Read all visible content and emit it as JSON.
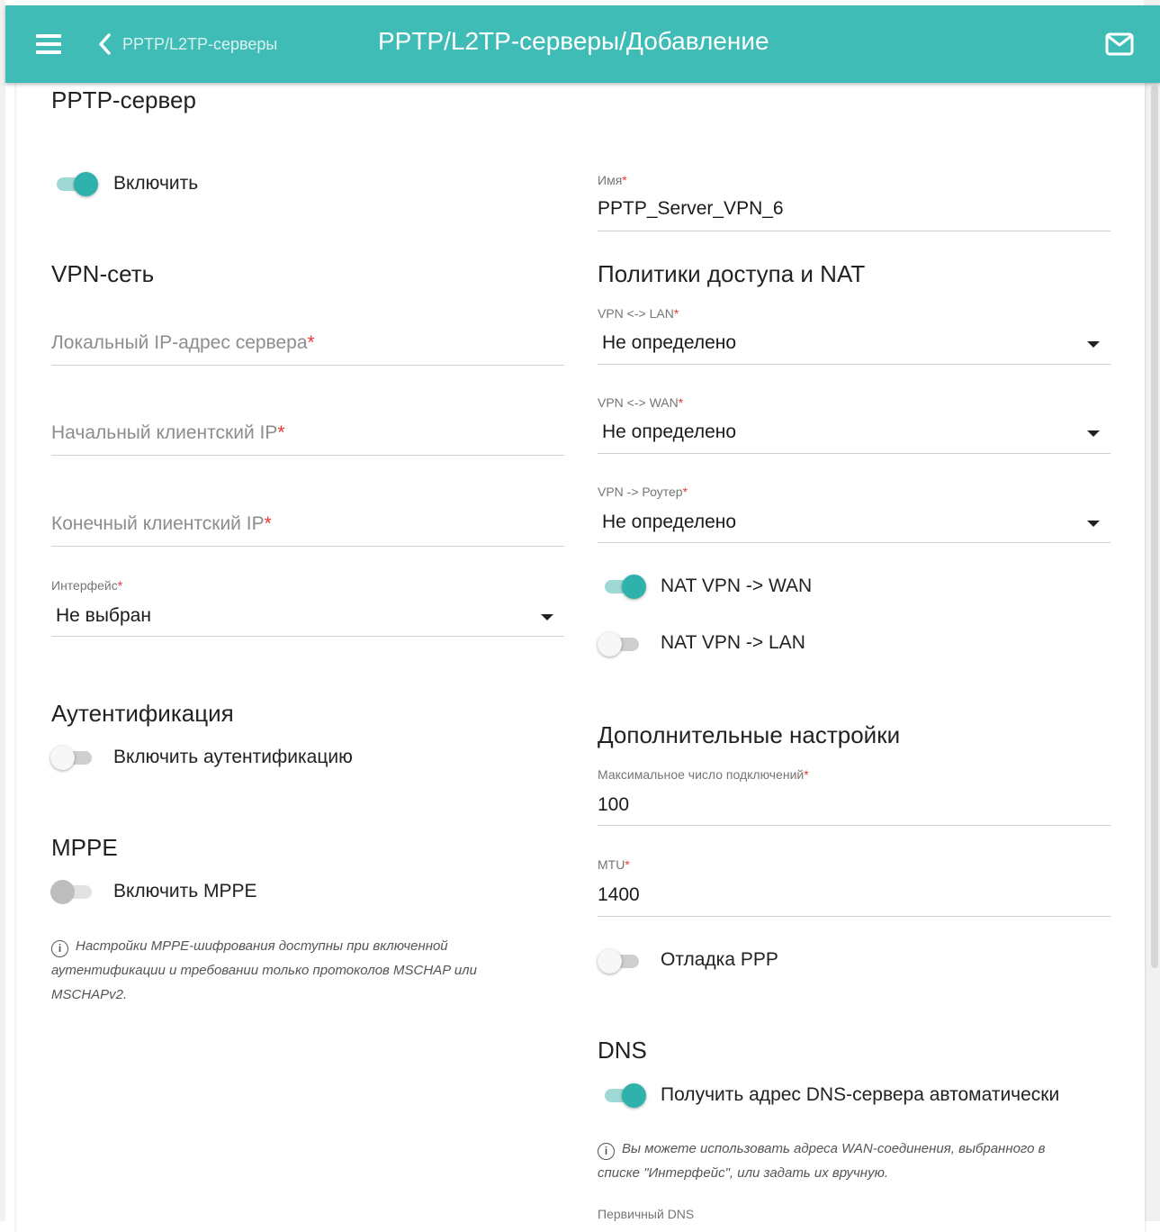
{
  "header": {
    "back_label": "PPTP/L2TP-серверы",
    "title": "PPTP/L2TP-серверы/Добавление",
    "bg_color": "#3fbcb6"
  },
  "server": {
    "heading": "PPTP-сервер",
    "enable_label": "Включить",
    "enable_state": true
  },
  "name_field": {
    "label": "Имя",
    "value": "PPTP_Server_VPN_6"
  },
  "vpn_net": {
    "heading": "VPN-сеть",
    "local_ip_placeholder": "Локальный IP-адрес сервера",
    "start_ip_placeholder": "Начальный клиентский IP",
    "end_ip_placeholder": "Конечный клиентский IP",
    "interface_label": "Интерфейс",
    "interface_value": "Не выбран"
  },
  "policies": {
    "heading": "Политики доступа и NAT",
    "vpn_lan_label": "VPN <-> LAN",
    "vpn_lan_value": "Не определено",
    "vpn_wan_label": "VPN <-> WAN",
    "vpn_wan_value": "Не определено",
    "vpn_router_label": "VPN -> Роутер",
    "vpn_router_value": "Не определено",
    "nat_wan_label": "NAT VPN -> WAN",
    "nat_wan_state": true,
    "nat_lan_label": "NAT VPN -> LAN",
    "nat_lan_state": false
  },
  "auth": {
    "heading": "Аутентификация",
    "enable_label": "Включить аутентификацию",
    "enable_state": false
  },
  "mppe": {
    "heading": "MPPE",
    "enable_label": "Включить MPPE",
    "enable_state": false,
    "note_line1": "Настройки MPPE-шифрования доступны при включенной",
    "note_line2": "аутентификации и требовании только протоколов MSCHAP или",
    "note_line3": "MSCHAPv2."
  },
  "advanced": {
    "heading": "Дополнительные настройки",
    "max_conn_label": "Максимальное число подключений",
    "max_conn_value": "100",
    "mtu_label": "MTU",
    "mtu_value": "1400",
    "debug_label": "Отладка PPP",
    "debug_state": false
  },
  "dns": {
    "heading": "DNS",
    "auto_label": "Получить адрес DNS-сервера автоматически",
    "auto_state": true,
    "note_line1": "Вы можете использовать адреса WAN-соединения, выбранного в",
    "note_line2": "списке \"Интерфейс\", или задать их вручную.",
    "primary_label": "Первичный DNS"
  },
  "required_mark": "*"
}
